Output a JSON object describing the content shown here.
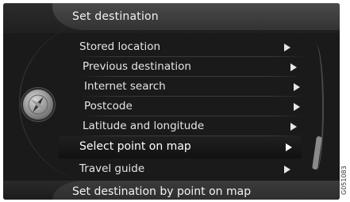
{
  "header": {
    "title": "Set destination"
  },
  "menu": {
    "items": [
      {
        "label": "Stored location",
        "selected": false
      },
      {
        "label": "Previous destination",
        "selected": false
      },
      {
        "label": "Internet search",
        "selected": false
      },
      {
        "label": "Postcode",
        "selected": false
      },
      {
        "label": "Latitude and longitude",
        "selected": false
      },
      {
        "label": "Select point on map",
        "selected": true
      },
      {
        "label": "Travel guide",
        "selected": false
      }
    ]
  },
  "footer": {
    "status": "Set destination by point on map"
  },
  "image_code": "G051083",
  "icons": {
    "emblem": "navigation-compass-icon",
    "submenu": "play-arrow-icon"
  },
  "colors": {
    "background": "#1a1a1a",
    "text": "#e6e6e6",
    "selected_text": "#ffffff"
  }
}
